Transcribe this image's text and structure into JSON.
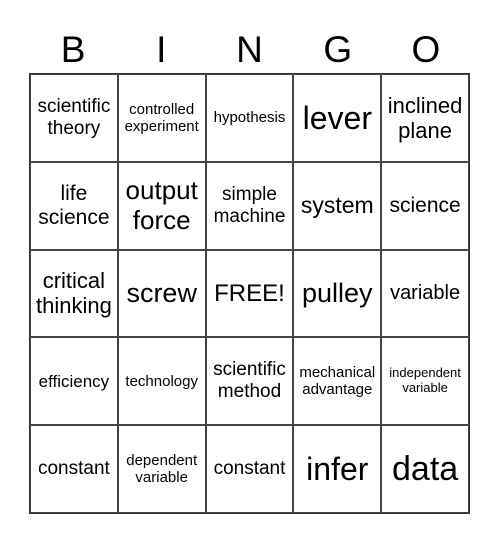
{
  "header": [
    "B",
    "I",
    "N",
    "G",
    "O"
  ],
  "cells": [
    "scientific theory",
    "controlled experiment",
    "hypothesis",
    "lever",
    "inclined plane",
    "life science",
    "output force",
    "simple machine",
    "system",
    "science",
    "critical thinking",
    "screw",
    "FREE!",
    "pulley",
    "variable",
    "efficiency",
    "technology",
    "scientific method",
    "mechanical advantage",
    "independent variable",
    "constant",
    "dependent variable",
    "constant",
    "infer",
    "data"
  ]
}
